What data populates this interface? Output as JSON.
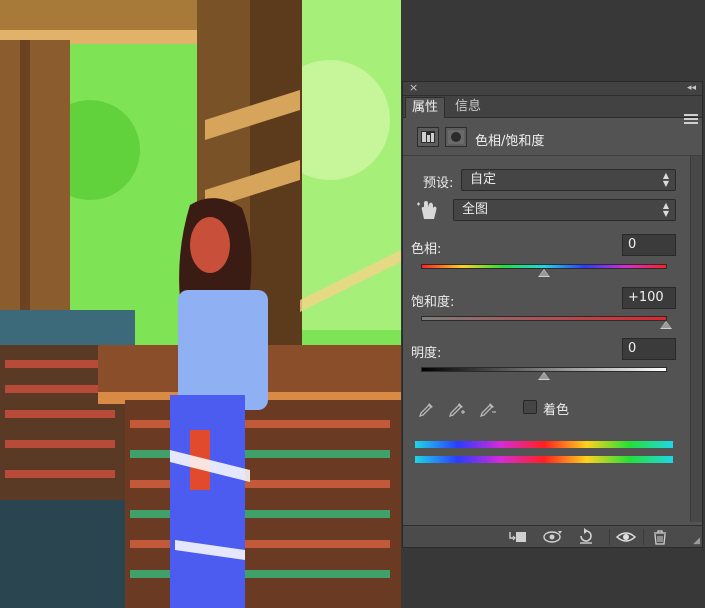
{
  "panel": {
    "tabs": [
      {
        "label": "属性",
        "active": true
      },
      {
        "label": "信息",
        "active": false
      }
    ],
    "topbar": {
      "close_glyph": "×",
      "collapse_glyph": "◂◂"
    },
    "adjustment_title": "色相/饱和度",
    "preset": {
      "label": "预设:",
      "value": "自定"
    },
    "channel": {
      "value": "全图"
    },
    "hue": {
      "label": "色相:",
      "value": "0"
    },
    "saturation": {
      "label": "饱和度:",
      "value": "+100"
    },
    "lightness": {
      "label": "明度:",
      "value": "0"
    },
    "colorize": {
      "label": "着色",
      "checked": false
    }
  },
  "colors": {
    "panel_bg": "#535353",
    "panel_dark": "#424242",
    "text": "#ececec",
    "saturation_accent": "#e0242c"
  },
  "icons": [
    "hue-saturation-icon",
    "mask-icon",
    "targeted-adjust-hand-icon",
    "eyedropper-icon",
    "eyedropper-plus-icon",
    "eyedropper-minus-icon",
    "clip-to-layer-icon",
    "view-previous-icon",
    "reset-icon",
    "visibility-icon",
    "delete-icon"
  ]
}
